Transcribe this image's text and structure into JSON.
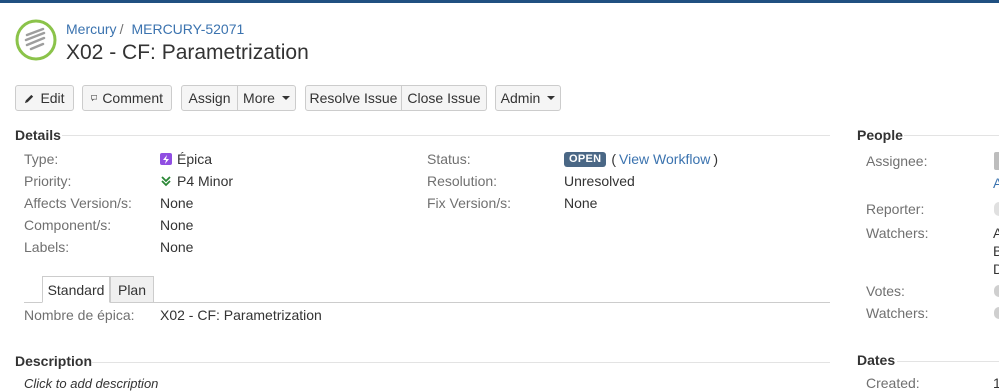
{
  "breadcrumb": {
    "project": "Mercury",
    "separator": "/",
    "issue_key": "MERCURY-52071"
  },
  "issue": {
    "title": "X02 - CF: Parametrization"
  },
  "toolbar": {
    "edit": "Edit",
    "comment": "Comment",
    "assign": "Assign",
    "more": "More",
    "resolve": "Resolve Issue",
    "close": "Close Issue",
    "admin": "Admin"
  },
  "details": {
    "title": "Details",
    "left": [
      {
        "label": "Type:",
        "value": "Épica",
        "icon": "epic-icon"
      },
      {
        "label": "Priority:",
        "value": "P4 Minor",
        "icon": "priority-minor-icon"
      },
      {
        "label": "Affects Version/s:",
        "value": "None"
      },
      {
        "label": "Component/s:",
        "value": "None"
      },
      {
        "label": "Labels:",
        "value": "None"
      }
    ],
    "right": [
      {
        "label": "Status:",
        "lozenge": "OPEN",
        "open_paren": "(",
        "link": "View Workflow",
        "close_paren": ")"
      },
      {
        "label": "Resolution:",
        "value": "Unresolved"
      },
      {
        "label": "Fix Version/s:",
        "value": "None"
      }
    ],
    "tabs": [
      {
        "label": "Standard",
        "active": true
      },
      {
        "label": "Plan",
        "active": false
      }
    ],
    "epic_field": {
      "label": "Nombre de épica:",
      "value": "X02 - CF: Parametrization"
    }
  },
  "description": {
    "title": "Description",
    "placeholder": "Click to add description"
  },
  "people": {
    "title": "People",
    "labels": {
      "assignee": "Assignee:",
      "reporter": "Reporter:",
      "watchers": "Watchers:",
      "votes": "Votes:",
      "watchers2": "Watchers:"
    },
    "partial_values": {
      "assignee_link": "A",
      "watchers_line1": "A",
      "watchers_line2": "B",
      "watchers_line3": "D"
    }
  },
  "dates": {
    "title": "Dates",
    "created_label": "Created:",
    "created_value_partial": "1"
  },
  "colors": {
    "link": "#3b73af",
    "header_bar": "#205081",
    "lozenge": "#4a6785",
    "epic": "#904ee2",
    "priority": "#2a8735"
  }
}
